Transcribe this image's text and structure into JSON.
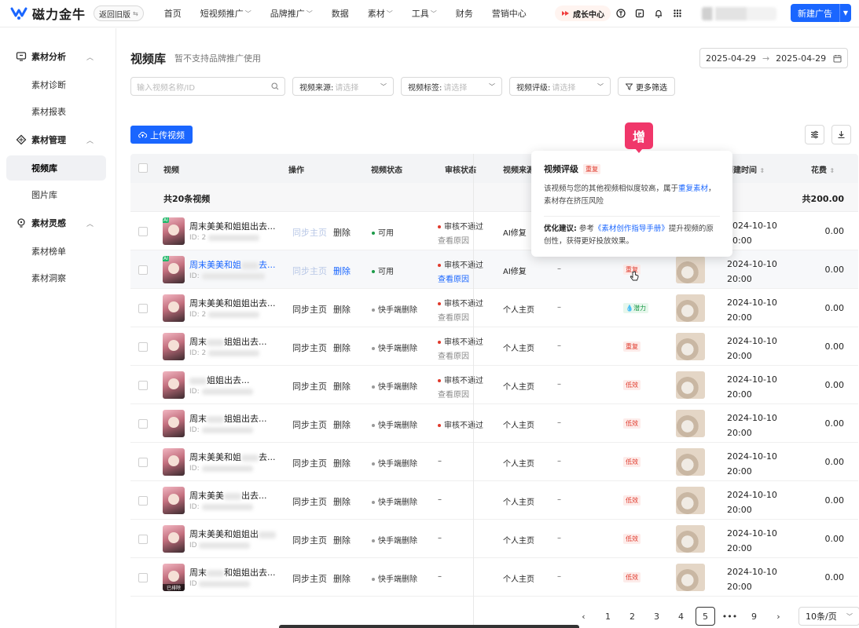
{
  "app": {
    "name": "磁力金牛",
    "back_label": "返回旧版"
  },
  "nav": {
    "items": [
      {
        "label": "首页",
        "dropdown": false
      },
      {
        "label": "短视频推广",
        "dropdown": true
      },
      {
        "label": "品牌推广",
        "dropdown": true
      },
      {
        "label": "数据",
        "dropdown": false
      },
      {
        "label": "素材",
        "dropdown": true
      },
      {
        "label": "工具",
        "dropdown": true
      },
      {
        "label": "财务",
        "dropdown": false
      },
      {
        "label": "营销中心",
        "dropdown": false
      }
    ],
    "growth_label": "成长中心",
    "new_ad_label": "新建广告"
  },
  "sidebar": {
    "groups": [
      {
        "label": "素材分析",
        "items": [
          "素材诊断",
          "素材报表"
        ]
      },
      {
        "label": "素材管理",
        "items": [
          "视频库",
          "图片库"
        ]
      },
      {
        "label": "素材灵感",
        "items": [
          "素材榜单",
          "素材洞察"
        ]
      }
    ],
    "active": "视频库"
  },
  "page": {
    "title": "视频库",
    "subtitle": "暂不支持品牌推广使用",
    "date_start": "2025-04-29",
    "date_sep": "→",
    "date_end": "2025-04-29"
  },
  "filters": {
    "search_placeholder": "输入视频名称/ID",
    "selects": [
      {
        "label": "视频来源:",
        "placeholder": "请选择"
      },
      {
        "label": "视频标签:",
        "placeholder": "请选择"
      },
      {
        "label": "视频评级:",
        "placeholder": "请选择"
      }
    ],
    "more_label": "更多筛选"
  },
  "upload_label": "上传视频",
  "table": {
    "headers": {
      "video": "视频",
      "op": "操作",
      "status": "视频状态",
      "review": "审核状态",
      "source": "视频来源",
      "created": "创建时间",
      "cost": "花费"
    },
    "summary": {
      "count": "共20条视频",
      "cost": "共200.00"
    },
    "rows": [
      {
        "title": "周末美美和姐姐出去...",
        "id": "ID: 2",
        "ai": true,
        "removed": false,
        "sync": "同步主页",
        "delete": "删除",
        "status": "可用",
        "status_color": "#1d9b49",
        "review": "审核不通过",
        "reason": "查看原因",
        "source": "AI修复",
        "dash": "",
        "rating": "",
        "rating_kind": "",
        "created_date": "2024-10-10",
        "created_time": "20:00",
        "cost": "0.00"
      },
      {
        "title": "周末美美和姐",
        "title_tail": "去...",
        "id": "ID:",
        "ai": true,
        "removed": false,
        "sync": "同步主页",
        "delete": "删除",
        "status": "可用",
        "status_color": "#1d9b49",
        "review": "审核不通过",
        "reason": "查看原因",
        "source": "AI修复",
        "dash": "–",
        "rating": "重复",
        "rating_kind": "dup",
        "created_date": "2024-10-10",
        "created_time": "20:00",
        "cost": "0.00"
      },
      {
        "title": "周末美美和姐姐出去...",
        "id": "ID: 2",
        "ai": false,
        "removed": false,
        "sync": "同步主页",
        "delete": "删除",
        "status": "快手端删除",
        "status_color": "#999999",
        "review": "审核不通过",
        "reason": "查看原因",
        "source": "个人主页",
        "dash": "–",
        "rating": "潜力",
        "rating_kind": "pot",
        "created_date": "2024-10-10",
        "created_time": "20:00",
        "cost": "0.00"
      },
      {
        "title": "周末",
        "title_tail": "姐姐出去...",
        "id": "ID: 2",
        "ai": false,
        "removed": false,
        "sync": "同步主页",
        "delete": "删除",
        "status": "快手端删除",
        "status_color": "#999999",
        "review": "审核不通过",
        "reason": "查看原因",
        "source": "个人主页",
        "dash": "–",
        "rating": "重复",
        "rating_kind": "dup",
        "created_date": "2024-10-10",
        "created_time": "20:00",
        "cost": "0.00"
      },
      {
        "title": "",
        "title_tail": "姐姐出去...",
        "id": "ID:",
        "ai": false,
        "removed": false,
        "sync": "同步主页",
        "delete": "删除",
        "status": "快手端删除",
        "status_color": "#999999",
        "review": "审核不通过",
        "reason": "查看原因",
        "source": "个人主页",
        "dash": "–",
        "rating": "低效",
        "rating_kind": "low",
        "created_date": "2024-10-10",
        "created_time": "20:00",
        "cost": "0.00"
      },
      {
        "title": "周末",
        "title_tail": "姐姐出去...",
        "id": "ID:",
        "ai": false,
        "removed": false,
        "sync": "同步主页",
        "delete": "删除",
        "status": "快手端删除",
        "status_color": "#999999",
        "review": "审核不通过",
        "reason": "",
        "source": "个人主页",
        "dash": "–",
        "rating": "低效",
        "rating_kind": "low",
        "created_date": "2024-10-10",
        "created_time": "20:00",
        "cost": "0.00"
      },
      {
        "title": "周末美美和姐",
        "title_tail": "去...",
        "id": "ID:",
        "ai": false,
        "removed": false,
        "sync": "同步主页",
        "delete": "删除",
        "status": "快手端删除",
        "status_color": "#999999",
        "review": "–",
        "reason": "",
        "source": "个人主页",
        "dash": "–",
        "rating": "低效",
        "rating_kind": "low",
        "created_date": "2024-10-10",
        "created_time": "20:00",
        "cost": "0.00"
      },
      {
        "title": "周末美美",
        "title_tail": "出去...",
        "id": "ID:",
        "ai": false,
        "removed": false,
        "sync": "同步主页",
        "delete": "删除",
        "status": "快手端删除",
        "status_color": "#999999",
        "review": "–",
        "reason": "",
        "source": "个人主页",
        "dash": "–",
        "rating": "低效",
        "rating_kind": "low",
        "created_date": "2024-10-10",
        "created_time": "20:00",
        "cost": "0.00"
      },
      {
        "title": "周末美美和姐姐出",
        "title_tail": "",
        "id": "ID",
        "ai": false,
        "removed": false,
        "sync": "同步主页",
        "delete": "删除",
        "status": "快手端删除",
        "status_color": "#999999",
        "review": "–",
        "reason": "",
        "source": "个人主页",
        "dash": "–",
        "rating": "低效",
        "rating_kind": "low",
        "created_date": "2024-10-10",
        "created_time": "20:00",
        "cost": "0.00"
      },
      {
        "title": "周末",
        "title_tail": "和姐姐出去...",
        "id": "ID",
        "ai": false,
        "removed": true,
        "removed_label": "已排除",
        "sync": "同步主页",
        "delete": "删除",
        "status": "快手端删除",
        "status_color": "#999999",
        "review": "–",
        "reason": "",
        "source": "个人主页",
        "dash": "–",
        "rating": "低效",
        "rating_kind": "low",
        "created_date": "2024-10-10",
        "created_time": "20:00",
        "cost": "0.00"
      }
    ]
  },
  "popover": {
    "title": "视频评级",
    "badge": "重复",
    "text_a": "该视频与您的其他视频相似度较高，属于",
    "text_link": "重复素材",
    "text_b": "，素材存在挤压风险",
    "sugg_label": "优化建议:",
    "sugg_a": " 参考",
    "sugg_link": "《素材创作指导手册》",
    "sugg_b": "提升视频的原创性，获得更好投放效果。"
  },
  "floating_badge": "增",
  "pagination": {
    "pages": [
      "1",
      "2",
      "3",
      "4",
      "5",
      "•••",
      "9"
    ],
    "active": "5",
    "page_size": "10条/页"
  },
  "colors": {
    "primary": "#1a66ff",
    "danger": "#e0392b",
    "success": "#1d9b49",
    "accent_pink": "#f0376a"
  }
}
